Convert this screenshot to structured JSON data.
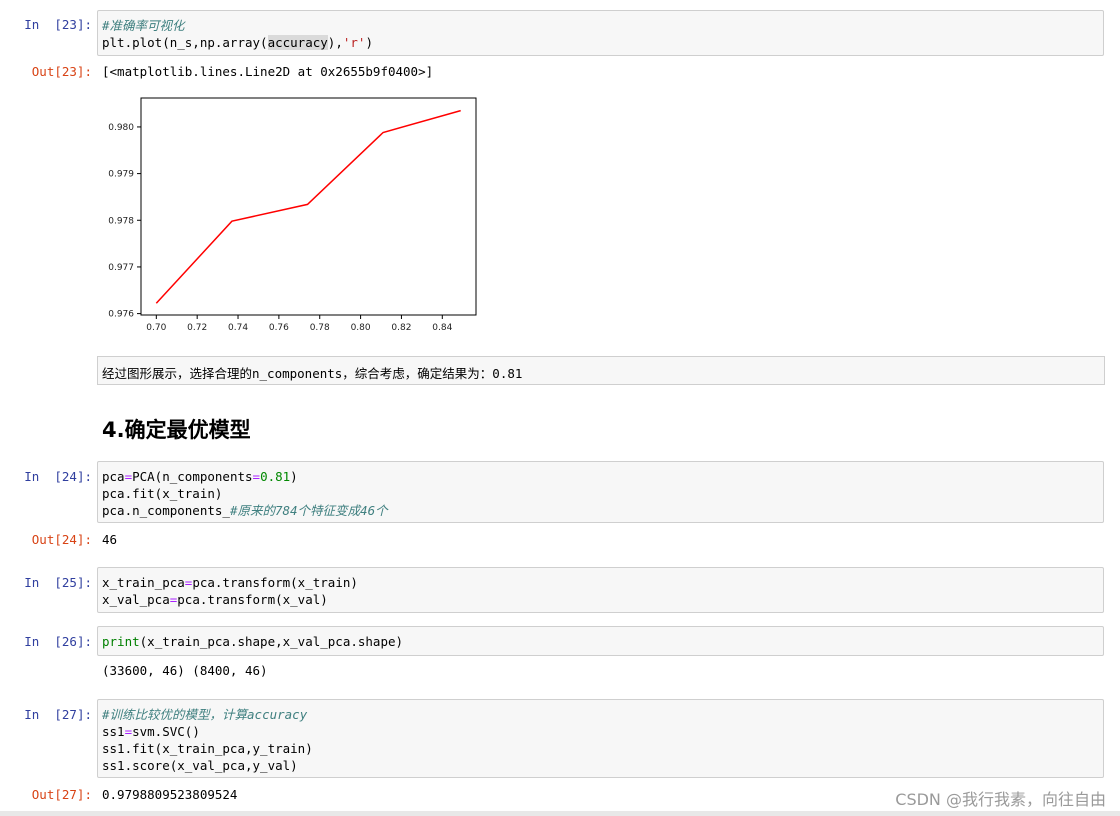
{
  "cells": {
    "c23": {
      "in_prompt": "In  [23]:",
      "out_prompt": "Out[23]:",
      "comment": "#准确率可视化",
      "code_l2_a": "plt.plot(n_s,np.array(",
      "code_l2_hl": "accuracy",
      "code_l2_b": "),",
      "code_l2_str": "'r'",
      "code_l2_c": ")",
      "output": "[<matplotlib.lines.Line2D at 0x2655b9f0400>]"
    },
    "md_conclusion": "经过图形展示，选择合理的n_components，综合考虑，确定结果为：0.81",
    "heading": "4.确定最优模型",
    "c24": {
      "in_prompt": "In  [24]:",
      "out_prompt": "Out[24]:",
      "l1_a": "pca",
      "l1_op": "=",
      "l1_b": "PCA(n_components",
      "l1_op2": "=",
      "l1_num": "0.81",
      "l1_c": ")",
      "l2": "pca.fit(x_train)",
      "l3_a": "pca.n_components_",
      "l3_cm": "#原来的784个特征变成46个",
      "output": "46"
    },
    "c25": {
      "in_prompt": "In  [25]:",
      "l1_a": "x_train_pca",
      "l1_op": "=",
      "l1_b": "pca.transform(x_train)",
      "l2_a": "x_val_pca",
      "l2_op": "=",
      "l2_b": "pca.transform(x_val)"
    },
    "c26": {
      "in_prompt": "In  [26]:",
      "l1_bi": "print",
      "l1_b": "(x_train_pca.shape,x_val_pca.shape)",
      "output": "(33600, 46) (8400, 46)"
    },
    "c27": {
      "in_prompt": "In  [27]:",
      "out_prompt": "Out[27]:",
      "comment": "#训练比较优的模型，计算accuracy",
      "l2_a": "ss1",
      "l2_op": "=",
      "l2_b": "svm.SVC()",
      "l3": "ss1.fit(x_train_pca,y_train)",
      "l4": "ss1.score(x_val_pca,y_val)",
      "output": "0.9798809523809524"
    }
  },
  "watermark": "CSDN @我行我素，向往自由",
  "chart_data": {
    "type": "line",
    "x": [
      0.7,
      0.737,
      0.774,
      0.811,
      0.849
    ],
    "y": [
      0.97622,
      0.97798,
      0.97834,
      0.97988,
      0.98035
    ],
    "color": "#ff0000",
    "xlim": [
      0.6925,
      0.8565
    ],
    "ylim": [
      0.97597,
      0.98062
    ],
    "xticks": [
      0.7,
      0.72,
      0.74,
      0.76,
      0.78,
      0.8,
      0.82,
      0.84
    ],
    "xtick_labels": [
      "0.70",
      "0.72",
      "0.74",
      "0.76",
      "0.78",
      "0.80",
      "0.82",
      "0.84"
    ],
    "yticks": [
      0.976,
      0.977,
      0.978,
      0.979,
      0.98
    ],
    "ytick_labels": [
      "0.976",
      "0.977",
      "0.978",
      "0.979",
      "0.980"
    ],
    "grid": false
  }
}
